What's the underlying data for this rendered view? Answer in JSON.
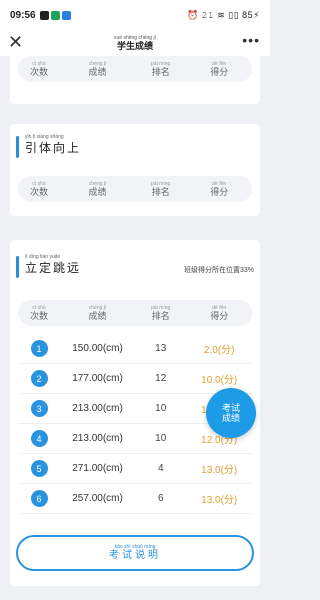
{
  "status": {
    "time": "09:56",
    "right": "⏰ 𝟸𝟷 ≋ ▯▯ 85⚡"
  },
  "nav": {
    "title_py": "xué shēng chéng jì",
    "title": "学生成绩",
    "more": "•••"
  },
  "columns": [
    {
      "py": "cì shù",
      "hz": "次数"
    },
    {
      "py": "chéng jì",
      "hz": "成绩"
    },
    {
      "py": "pái míng",
      "hz": "排名"
    },
    {
      "py": "dé fēn",
      "hz": "得分"
    }
  ],
  "pullup": {
    "title_py": "yǐn tǐ xiàng shàng",
    "title": "引体向上"
  },
  "longjump": {
    "title_py": "lì dìng tiào yuǎn",
    "title": "立定跳远",
    "note": "班级得分所在位置33%",
    "rows": [
      {
        "n": "1",
        "value": "150.00(cm)",
        "rank": "13",
        "score": "2.0(分)"
      },
      {
        "n": "2",
        "value": "177.00(cm)",
        "rank": "12",
        "score": "10.0(分)"
      },
      {
        "n": "3",
        "value": "213.00(cm)",
        "rank": "10",
        "score": "12.0(分)"
      },
      {
        "n": "4",
        "value": "213.00(cm)",
        "rank": "10",
        "score": "12.0(分)"
      },
      {
        "n": "5",
        "value": "271.00(cm)",
        "rank": "4",
        "score": "13.0(分)"
      },
      {
        "n": "6",
        "value": "257.00(cm)",
        "rank": "6",
        "score": "13.0(分)"
      }
    ]
  },
  "fab": {
    "label": "考试成绩"
  },
  "bottom": {
    "py": "kǎo shì shuō míng",
    "label": "考试说明"
  },
  "colors": {
    "accent": "#2a93e0",
    "score": "#e0a030"
  }
}
